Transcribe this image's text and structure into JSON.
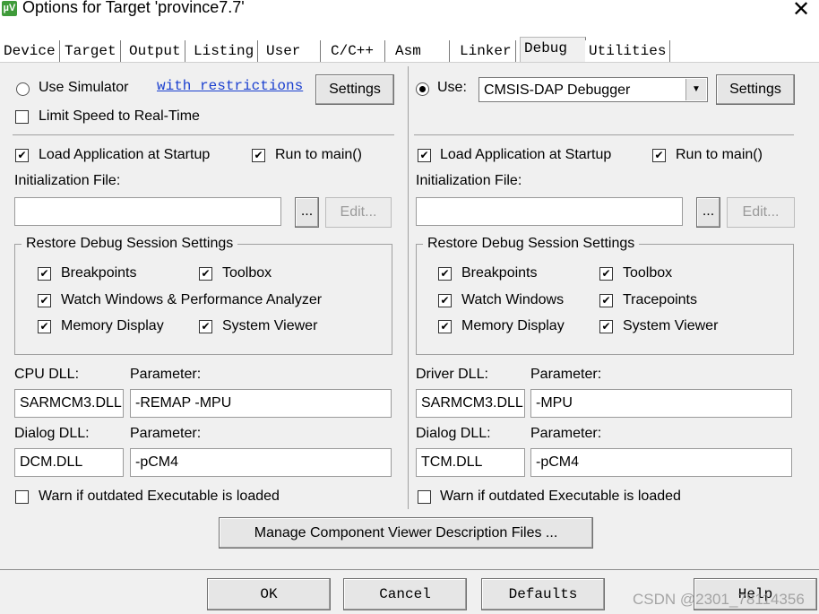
{
  "window": {
    "title": "Options for Target 'province7.7'",
    "app_icon": "µV"
  },
  "tabs": [
    "Device",
    "Target",
    "Output",
    "Listing",
    "User",
    "C/C++",
    "Asm",
    "Linker",
    "Debug",
    "Utilities"
  ],
  "left": {
    "use_simulator": "Use Simulator",
    "restrictions_link": "with restrictions",
    "settings": "Settings",
    "limit_speed": "Limit Speed to Real-Time",
    "load_app": "Load Application at Startup",
    "run_main": "Run to main()",
    "init_file": "Initialization File:",
    "browse": "...",
    "edit": "Edit...",
    "restore_group": "Restore Debug Session Settings",
    "breakpoints": "Breakpoints",
    "toolbox": "Toolbox",
    "watch_windows": "Watch Windows & Performance Analyzer",
    "memory_display": "Memory Display",
    "system_viewer": "System Viewer",
    "dll_label": "CPU DLL:",
    "param_label": "Parameter:",
    "dll_value": "SARMCM3.DLL",
    "dll_param": "-REMAP -MPU",
    "dialog_dll_label": "Dialog DLL:",
    "dialog_param_label": "Parameter:",
    "dialog_dll_value": "DCM.DLL",
    "dialog_param": "-pCM4",
    "warn": "Warn if outdated Executable is loaded"
  },
  "right": {
    "use": "Use:",
    "debugger": "CMSIS-DAP Debugger",
    "settings": "Settings",
    "load_app": "Load Application at Startup",
    "run_main": "Run to main()",
    "init_file": "Initialization File:",
    "browse": "...",
    "edit": "Edit...",
    "restore_group": "Restore Debug Session Settings",
    "breakpoints": "Breakpoints",
    "toolbox": "Toolbox",
    "watch_windows": "Watch Windows",
    "tracepoints": "Tracepoints",
    "memory_display": "Memory Display",
    "system_viewer": "System Viewer",
    "dll_label": "Driver DLL:",
    "param_label": "Parameter:",
    "dll_value": "SARMCM3.DLL",
    "dll_param": "-MPU",
    "dialog_dll_label": "Dialog DLL:",
    "dialog_param_label": "Parameter:",
    "dialog_dll_value": "TCM.DLL",
    "dialog_param": "-pCM4",
    "warn": "Warn if outdated Executable is loaded"
  },
  "manage_button": "Manage Component Viewer Description Files ...",
  "dialog_buttons": {
    "ok": "OK",
    "cancel": "Cancel",
    "defaults": "Defaults",
    "help": "Help"
  },
  "watermark": "CSDN @2301_78114356",
  "check_mark": "✔",
  "dropdown_arrow": "▼",
  "close_glyph": "✕"
}
